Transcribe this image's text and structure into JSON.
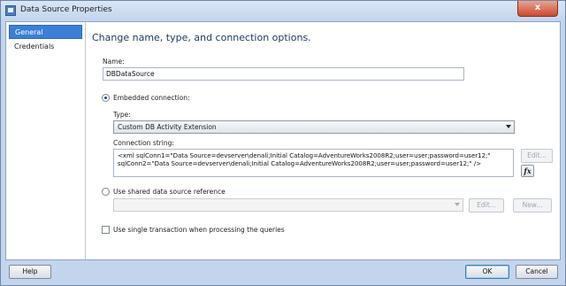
{
  "window": {
    "title": "Data Source Properties",
    "close_glyph": "x"
  },
  "nav": {
    "items": [
      {
        "label": "General",
        "selected": true
      },
      {
        "label": "Credentials",
        "selected": false
      }
    ]
  },
  "main": {
    "heading": "Change name, type, and connection options.",
    "name": {
      "label": "Name:",
      "value": "DBDataSource"
    },
    "embedded": {
      "label": "Embedded connection:",
      "selected": true,
      "type_label": "Type:",
      "type_value": "Custom DB Activity Extension",
      "conn_label": "Connection string:",
      "conn_value": "<xml sqlConn1=\"Data Source=devserver\\denali;Initial Catalog=AdventureWorks2008R2;user=user;password=user12;\"\nsqlConn2=\"Data Source=devserver\\denali;Initial Catalog=AdventureWorks2008R2;user=user;password=user12;\" />",
      "edit_label": "Edit...",
      "fx_label": "fx"
    },
    "shared": {
      "label": "Use shared data source reference",
      "selected": false,
      "select_value": "",
      "edit_label": "Edit...",
      "new_label": "New..."
    },
    "single_transaction": {
      "label": "Use single transaction when processing the queries",
      "checked": false
    }
  },
  "footer": {
    "help_label": "Help",
    "ok_label": "OK",
    "cancel_label": "Cancel"
  }
}
